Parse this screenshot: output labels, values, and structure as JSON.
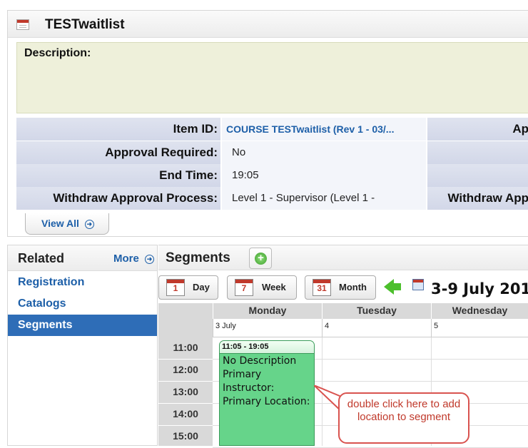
{
  "header": {
    "title": "TESTwaitlist"
  },
  "description": {
    "label": "Description:"
  },
  "details": {
    "rows": [
      {
        "label": "Item ID:",
        "value": "COURSE TESTwaitlist (Rev 1 - 03/...",
        "label2": "Ap"
      },
      {
        "label": "Approval Required:",
        "value": "No",
        "label2": ""
      },
      {
        "label": "End Time:",
        "value": "19:05",
        "label2": ""
      },
      {
        "label": "Withdraw Approval Process:",
        "value": "Level 1 - Supervisor (Level 1 -",
        "label2": "Withdraw App"
      }
    ],
    "view_all": "View All"
  },
  "related": {
    "title": "Related",
    "more": "More",
    "items": [
      {
        "label": "Registration"
      },
      {
        "label": "Catalogs"
      },
      {
        "label": "Segments"
      }
    ]
  },
  "segments": {
    "title": "Segments",
    "views": [
      {
        "label": "Day",
        "icon_num": "1"
      },
      {
        "label": "Week",
        "icon_num": "7"
      },
      {
        "label": "Month",
        "icon_num": "31"
      }
    ],
    "date_range": "3-9 July 201",
    "days": [
      {
        "name": "Monday",
        "date": "3 July"
      },
      {
        "name": "Tuesday",
        "date": "4"
      },
      {
        "name": "Wednesday",
        "date": "5"
      }
    ],
    "times": [
      "11:00",
      "12:00",
      "13:00",
      "14:00",
      "15:00"
    ],
    "event": {
      "time": "11:05 - 19:05",
      "lines": [
        "No Description",
        "Primary",
        "Instructor:",
        "Primary Location:"
      ]
    }
  },
  "callout": {
    "text": "double click here to add location to segment"
  },
  "colors": {
    "accent": "#1d5fa8",
    "active": "#2e6db7",
    "event": "#66d48a",
    "callout": "#d9534f"
  }
}
